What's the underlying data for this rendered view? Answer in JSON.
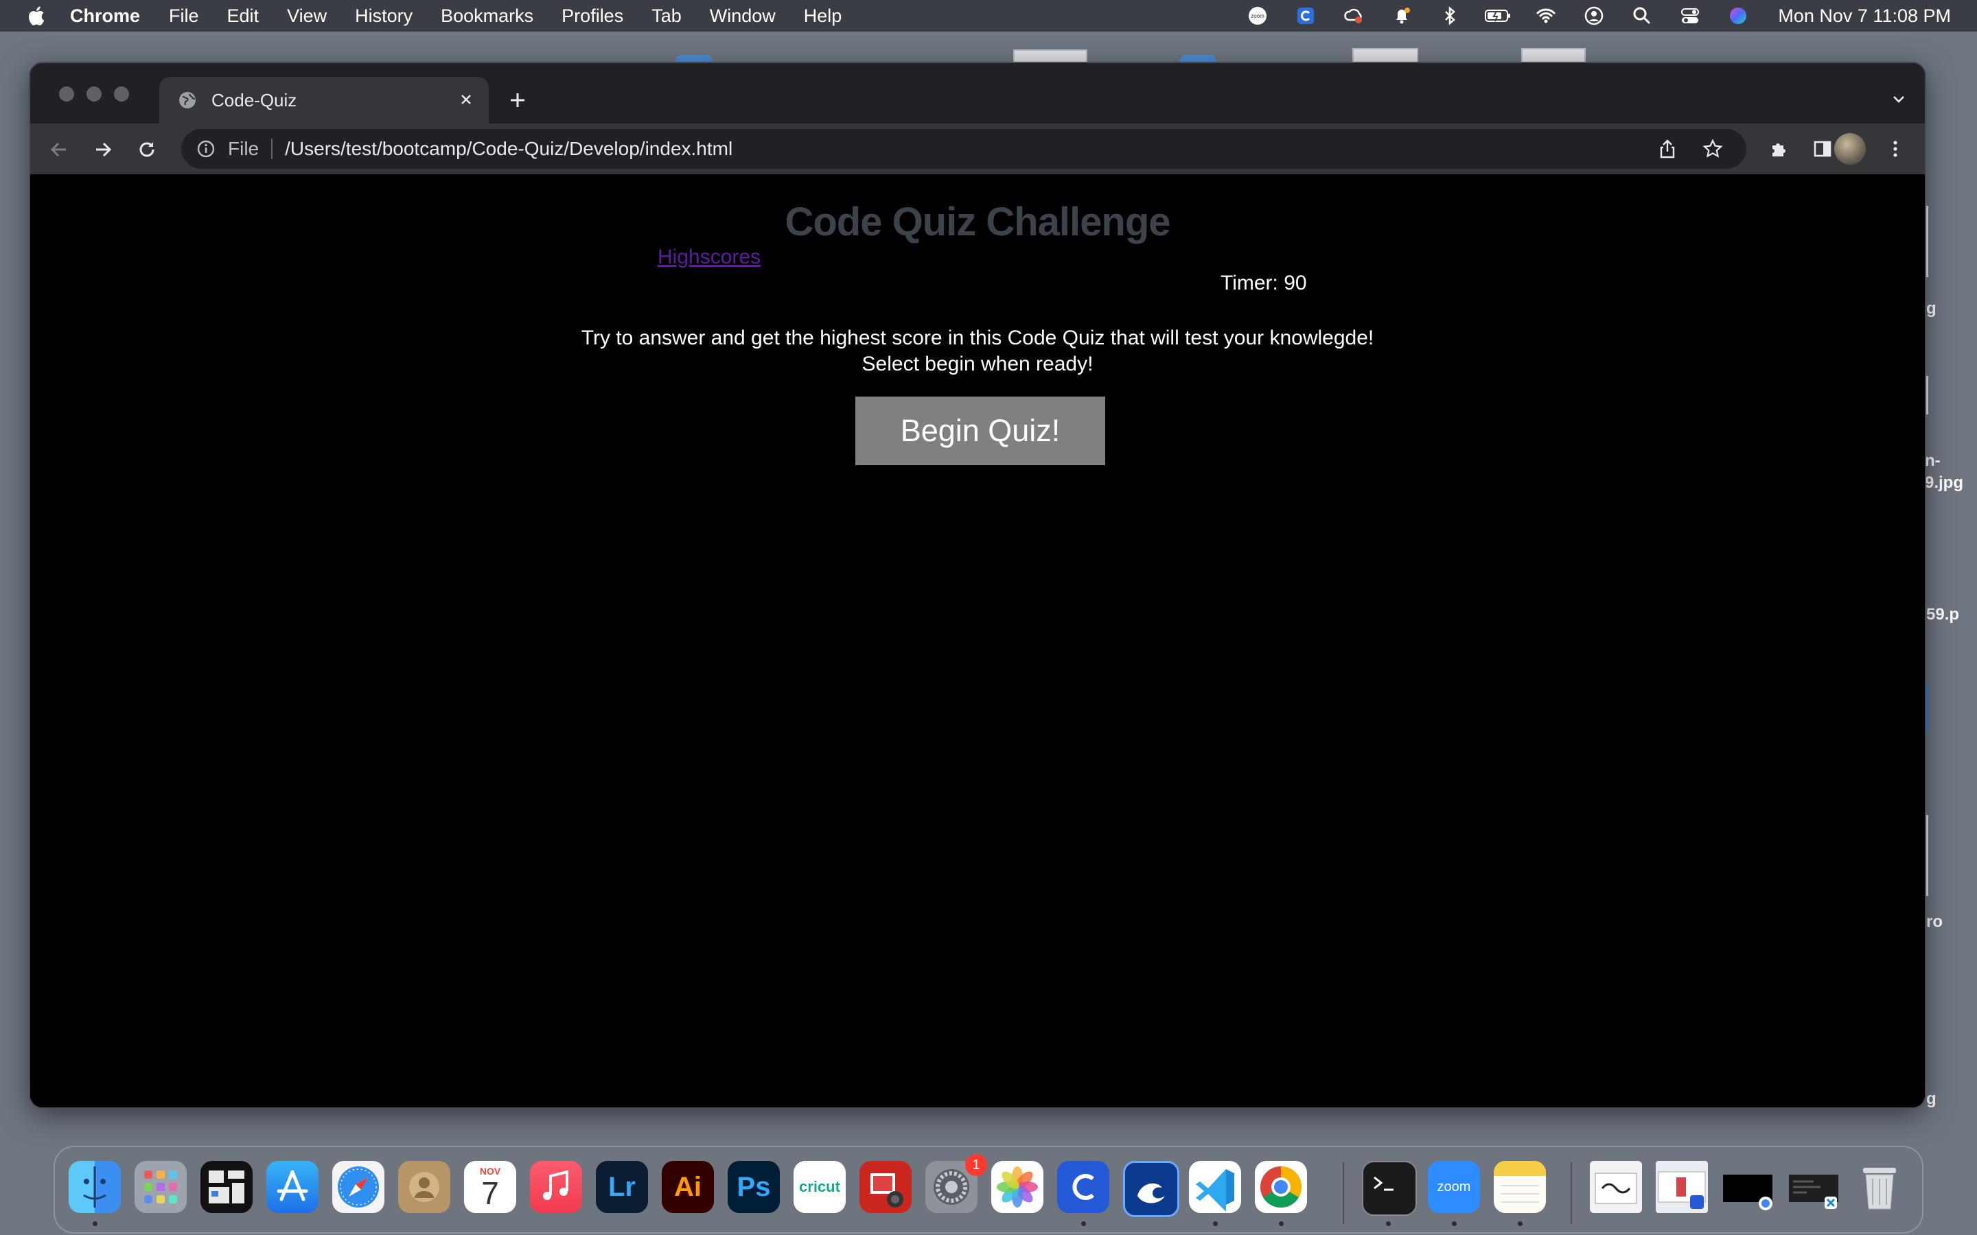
{
  "menubar": {
    "app_name": "Chrome",
    "items": [
      "File",
      "Edit",
      "View",
      "History",
      "Bookmarks",
      "Profiles",
      "Tab",
      "Window",
      "Help"
    ],
    "clock": "Mon Nov 7  11:08 PM",
    "status_icons": [
      "zoom-icon",
      "cisco-icon",
      "creative-cloud-icon",
      "notification-icon",
      "bluetooth-icon",
      "battery-icon",
      "wifi-icon",
      "user-icon",
      "spotlight-icon",
      "control-center-icon",
      "siri-icon"
    ]
  },
  "desktop": {
    "labels": [
      "g",
      "n-",
      "9.jpg",
      "59.p",
      "ro",
      "g"
    ]
  },
  "browser": {
    "tab_title": "Code-Quiz",
    "url_chip": "File",
    "url": "/Users/test/bootcamp/Code-Quiz/Develop/index.html"
  },
  "page": {
    "title": "Code Quiz Challenge",
    "highscores_link": "Highscores",
    "timer": "Timer: 90",
    "intro_line1": "Try to answer and get the highest score in this Code Quiz that will test your knowlegde!",
    "intro_line2": "Select begin when ready!",
    "begin_button": "Begin Quiz!"
  },
  "dock": {
    "calendar_month": "NOV",
    "calendar_day": "7",
    "lightroom": "Lr",
    "illustrator": "Ai",
    "photoshop": "Ps",
    "cricut": "cricut",
    "settings_badge": "1",
    "zoom": "zoom"
  },
  "colors": {
    "page_title": "#3d434b",
    "link_visited": "#5a1e9e",
    "begin_button_bg": "#808080",
    "page_bg": "#000000"
  }
}
